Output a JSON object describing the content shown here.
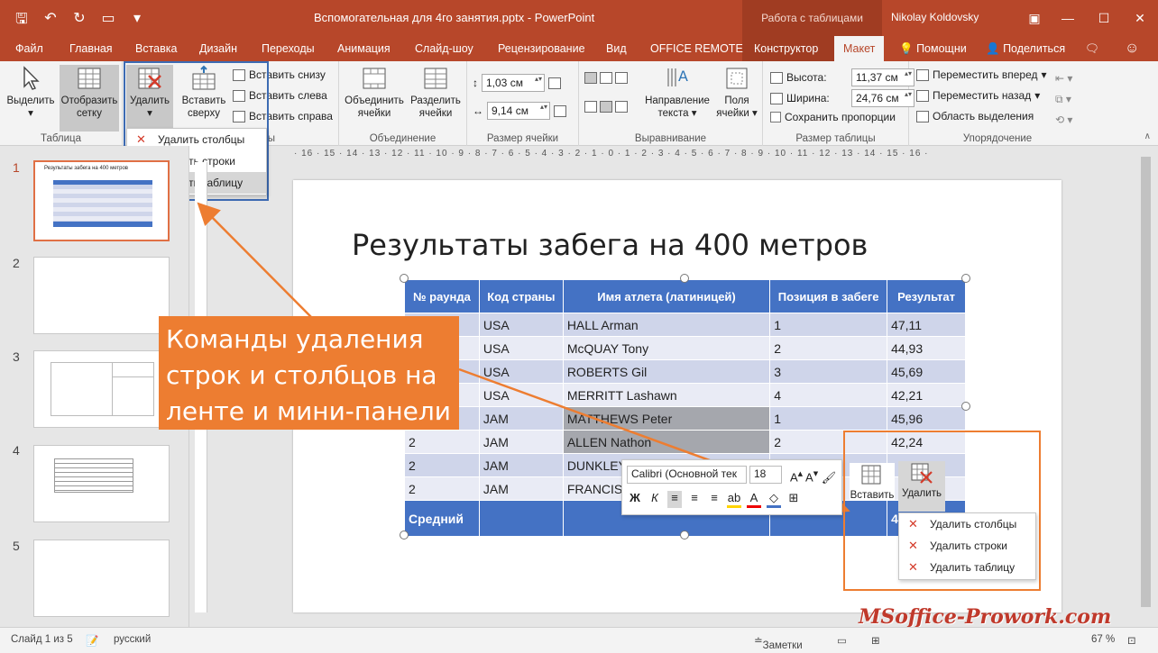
{
  "titlebar": {
    "doc_title": "Вспомогательная для 4го занятия.pptx - PowerPoint",
    "context_group": "Работа с таблицами",
    "user": "Nikolay Koldovsky"
  },
  "tabs": {
    "file": "Файл",
    "home": "Главная",
    "insert": "Вставка",
    "design": "Дизайн",
    "transitions": "Переходы",
    "animation": "Анимация",
    "slideshow": "Слайд-шоу",
    "review": "Рецензирование",
    "view": "Вид",
    "office_remote": "OFFICE REMOTE",
    "constructor": "Конструктор",
    "layout": "Макет",
    "help": "Помощни",
    "share": "Поделиться"
  },
  "ribbon": {
    "table_group": {
      "label": "Таблица",
      "select": "Выделить",
      "grid": "Отобразить сетку"
    },
    "rows_cols": {
      "delete": "Удалить",
      "insert_above": "Вставить сверху",
      "insert_below": "Вставить снизу",
      "insert_left": "Вставить слева",
      "insert_right": "Вставить справа",
      "group_tail": "ы"
    },
    "delete_menu": [
      "Удалить столбцы",
      "Удалить строки",
      "Удалить таблицу"
    ],
    "merge": {
      "label": "Объединение",
      "merge": "Объединить ячейки",
      "split": "Разделить ячейки"
    },
    "cell_size": {
      "label": "Размер ячейки",
      "height": "1,03 см",
      "width": "9,14 см"
    },
    "alignment": {
      "label": "Выравнивание",
      "direction": "Направление текста",
      "margins": "Поля ячейки"
    },
    "table_size": {
      "label": "Размер таблицы",
      "height_label": "Высота:",
      "height": "11,37 см",
      "width_label": "Ширина:",
      "width": "24,76 см",
      "lock": "Сохранить пропорции"
    },
    "arrange": {
      "label": "Упорядочение",
      "forward": "Переместить вперед",
      "backward": "Переместить назад",
      "selection": "Область выделения"
    }
  },
  "thumbnails": [
    {
      "num": "1",
      "title": "Результаты забега на 400 метров"
    },
    {
      "num": "2"
    },
    {
      "num": "3"
    },
    {
      "num": "4"
    },
    {
      "num": "5"
    }
  ],
  "ruler": "· 16 · 15 · 14 · 13 · 12 · 11 · 10 · 9 · 8 · 7 · 6 · 5 · 4 · 3 · 2 · 1 · 0 · 1 · 2 · 3 · 4 · 5 · 6 · 7 · 8 · 9 · 10 · 11 · 12 · 13 · 14 · 15 · 16 ·",
  "slide": {
    "title": "Результаты забега на 400 метров",
    "table": {
      "headers": [
        "№ раунда",
        "Код страны",
        "Имя атлета (латиницей)",
        "Позиция в забеге",
        "Результат"
      ],
      "rows": [
        [
          "",
          "USA",
          "HALL Arman",
          "1",
          "47,11"
        ],
        [
          "",
          "USA",
          "McQUAY Tony",
          "2",
          "44,93"
        ],
        [
          "",
          "USA",
          "ROBERTS Gil",
          "3",
          "45,69"
        ],
        [
          "",
          "USA",
          "MERRITT Lashawn",
          "4",
          "42,21"
        ],
        [
          "",
          "JAM",
          "MATTHEWS Peter",
          "1",
          "45,96"
        ],
        [
          "2",
          "JAM",
          "ALLEN Nathon",
          "2",
          "42,24"
        ],
        [
          "2",
          "JAM",
          "DUNKLEY",
          "",
          ""
        ],
        [
          "2",
          "JAM",
          "FRANCIS",
          "",
          ""
        ]
      ],
      "footer": [
        "Средний",
        "",
        "",
        "",
        "4"
      ]
    }
  },
  "callout": [
    "Команды удаления",
    "строк и столбцов на",
    "ленте и мини-панели"
  ],
  "minibar": {
    "font": "Calibri (Основной тек",
    "size": "18",
    "insert": "Вставить",
    "delete": "Удалить",
    "menu": [
      "Удалить столбцы",
      "Удалить строки",
      "Удалить таблицу"
    ]
  },
  "status": {
    "slide": "Слайд 1 из 5",
    "lang": "русский",
    "notes": "Заметки",
    "zoom": "67 %"
  },
  "watermark": "MSoffice-Prowork.com",
  "colors": {
    "accent": "#b7472a",
    "table_header": "#4472c4",
    "callout": "#ed7d31",
    "box_blue": "#3d6bb3"
  }
}
